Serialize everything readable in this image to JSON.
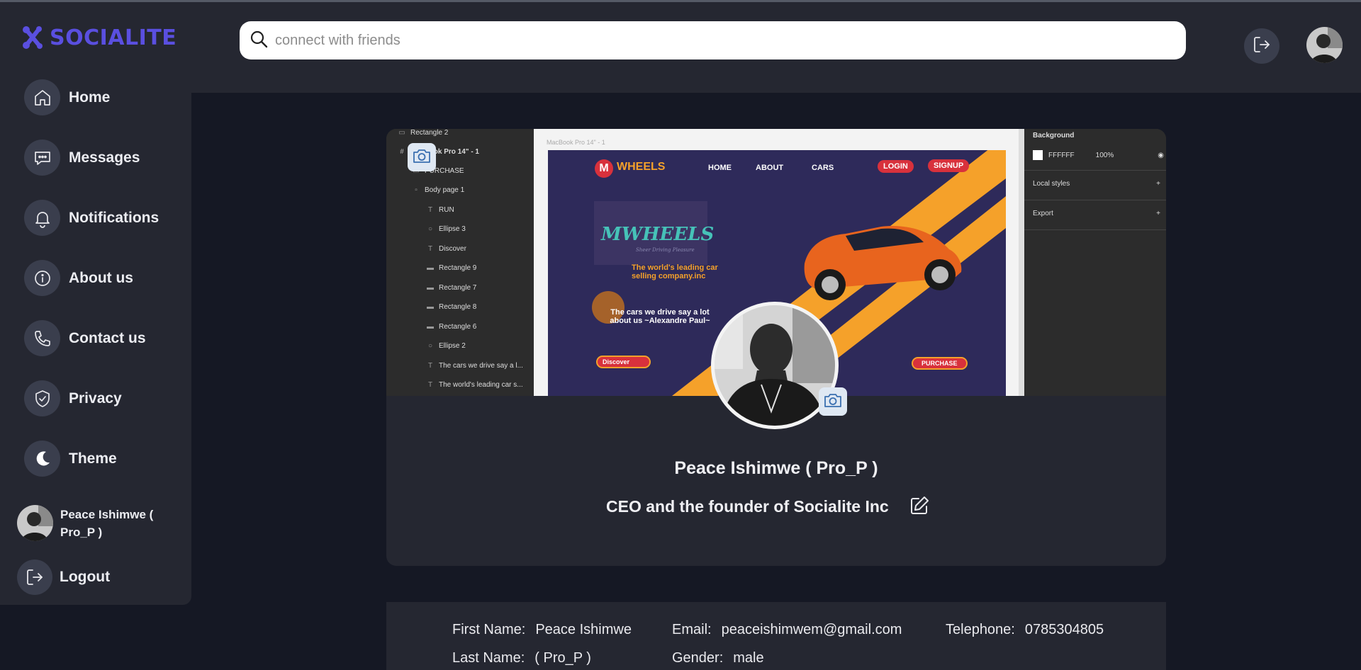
{
  "header": {
    "logo_text": "SOCIALITE",
    "search_placeholder": "connect with friends"
  },
  "sidebar": {
    "items": [
      {
        "label": "Home"
      },
      {
        "label": "Messages"
      },
      {
        "label": "Notifications"
      },
      {
        "label": "About us"
      },
      {
        "label": "Contact us"
      },
      {
        "label": "Privacy"
      },
      {
        "label": "Theme"
      }
    ],
    "user_name": "Peace Ishimwe ( Pro_P )",
    "logout_label": "Logout"
  },
  "cover": {
    "layers": [
      "Rectangle 2",
      "MacBook Pro 14\" - 1",
      "PURCHASE",
      "Body  page 1",
      "RUN",
      "Ellipse 3",
      "Discover",
      "Rectangle 9",
      "Rectangle 7",
      "Rectangle 8",
      "Rectangle 6",
      "Ellipse 2",
      "The cars we drive say a l...",
      "The world's leading car s..."
    ],
    "frame_label": "MacBook Pro 14\" - 1",
    "site": {
      "brand": "WHEELS",
      "brand_letter": "M",
      "nav": [
        "HOME",
        "ABOUT",
        "CARS"
      ],
      "login": "LOGIN",
      "signup": "SIGNUP",
      "logo_text": "MWHEELS",
      "logo_tag": "Sheer Driving Pleasure",
      "tagline": "The world's leading car selling company.inc",
      "quote": "The cars we drive say a lot about us ~Alexandre Paul~",
      "discover": "Discover",
      "purchase": "PURCHASE"
    },
    "right_panel": {
      "background_title": "Background",
      "bg_hex": "FFFFFF",
      "bg_opacity": "100%",
      "local_styles": "Local styles",
      "export": "Export"
    }
  },
  "profile": {
    "name": "Peace Ishimwe ( Pro_P )",
    "bio": "CEO and the founder of Socialite Inc"
  },
  "info": {
    "first_name_label": "First Name:",
    "first_name": "Peace Ishimwe",
    "last_name_label": "Last Name:",
    "last_name": "( Pro_P )",
    "email_label": "Email:",
    "email": "peaceishimwem@gmail.com",
    "gender_label": "Gender:",
    "gender": "male",
    "telephone_label": "Telephone:",
    "telephone": "0785304805"
  },
  "colors": {
    "brand": "#5a4fe0",
    "panel": "#252731",
    "background": "#151824",
    "icon_circle": "#3a3e4d",
    "wheels_orange": "#f5a12a",
    "wheels_red": "#d8313c"
  }
}
